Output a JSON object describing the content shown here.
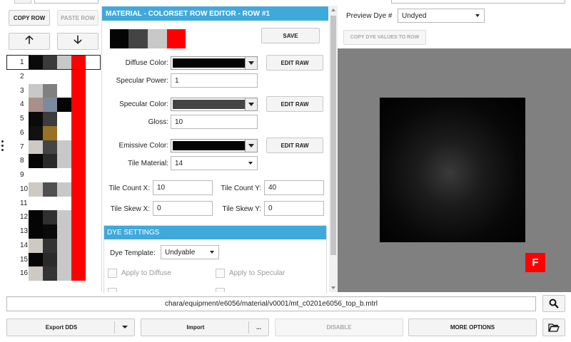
{
  "left_panel": {
    "copy_row": "COPY ROW",
    "paste_row": "PASTE ROW",
    "up_arrow": "🡡",
    "down_arrow": "🡣",
    "rows": [
      {
        "num": "1",
        "colors": [
          "#0a0a0a",
          "#3a3a3a",
          "#c8c8c8",
          "#ff0000"
        ]
      },
      {
        "num": "2",
        "colors": [
          "#ffffff",
          "#ffffff",
          "#ffffff",
          "#ff0000"
        ]
      },
      {
        "num": "3",
        "colors": [
          "#c8c8c8",
          "#808080",
          "#ffffff",
          "#ff0000"
        ]
      },
      {
        "num": "4",
        "colors": [
          "#a89088",
          "#7c8aa0",
          "#050505",
          "#ff0000"
        ]
      },
      {
        "num": "5",
        "colors": [
          "#0a0a0a",
          "#3c3c3c",
          "#ffffff",
          "#ff0000"
        ]
      },
      {
        "num": "6",
        "colors": [
          "#111111",
          "#9a7024",
          "#ffffff",
          "#ff0000"
        ]
      },
      {
        "num": "7",
        "colors": [
          "#cfc9c4",
          "#444444",
          "#c8c8c8",
          "#ff0000"
        ]
      },
      {
        "num": "8",
        "colors": [
          "#050505",
          "#2a2a2a",
          "#c8c8c8",
          "#ff0000"
        ]
      },
      {
        "num": "9",
        "colors": [
          "#ffffff",
          "#ffffff",
          "#ffffff",
          "#ff0000"
        ]
      },
      {
        "num": "10",
        "colors": [
          "#cfc9c4",
          "#505050",
          "#c8c8c8",
          "#ff0000"
        ]
      },
      {
        "num": "11",
        "colors": [
          "#ffffff",
          "#ffffff",
          "#ffffff",
          "#ff0000"
        ]
      },
      {
        "num": "12",
        "colors": [
          "#050505",
          "#303030",
          "#c8c8c8",
          "#ff0000"
        ]
      },
      {
        "num": "13",
        "colors": [
          "#050505",
          "#0a0a0a",
          "#c8c8c8",
          "#ff0000"
        ]
      },
      {
        "num": "14",
        "colors": [
          "#cfc9c4",
          "#333333",
          "#c8c8c8",
          "#ff0000"
        ]
      },
      {
        "num": "15",
        "colors": [
          "#050505",
          "#2a2a2a",
          "#c8c8c8",
          "#ff0000"
        ]
      },
      {
        "num": "16",
        "colors": [
          "#cfc9c4",
          "#333333",
          "#c8c8c8",
          "#ff0000"
        ]
      }
    ]
  },
  "editor": {
    "header": "MATERIAL - COLORSET ROW EDITOR - ROW #1",
    "preview_colors": [
      "#050505",
      "#444444",
      "#c8c8c8",
      "#ff0000"
    ],
    "save": "SAVE",
    "diffuse_label": "Diffuse Color:",
    "diffuse_color": "#050505",
    "edit_raw": "EDIT RAW",
    "specular_power_label": "Specular Power:",
    "specular_power": "1",
    "specular_color_label": "Specular Color:",
    "specular_color": "#444444",
    "gloss_label": "Gloss:",
    "gloss": "10",
    "emissive_label": "Emissive Color:",
    "emissive_color": "#050505",
    "tile_material_label": "Tile Material:",
    "tile_material": "14",
    "tile_count_x_label": "Tile Count X:",
    "tile_count_x": "10",
    "tile_count_y_label": "Tile Count Y:",
    "tile_count_y": "40",
    "tile_skew_x_label": "Tile Skew X:",
    "tile_skew_x": "0",
    "tile_skew_y_label": "Tile Skew Y:",
    "tile_skew_y": "0"
  },
  "dye": {
    "header": "DYE SETTINGS",
    "template_label": "Dye Template:",
    "template_value": "Undyable",
    "apply_diffuse": "Apply to Diffuse",
    "apply_specular": "Apply to Specular"
  },
  "preview": {
    "dye_label": "Preview Dye #",
    "dye_value": "Undyed",
    "copy_dye": "COPY DYE VALUES TO ROW",
    "f_badge": "F"
  },
  "bottom": {
    "path": "chara/equipment/e6056/material/v0001/mt_c0201e6056_top_b.mtrl",
    "export": "Export DDS",
    "import": "Import",
    "ellipsis": "...",
    "disable": "DISABLE",
    "more_options": "MORE OPTIONS"
  },
  "colors": {
    "accent": "#3fa9db",
    "badge_red": "#ff0000"
  }
}
